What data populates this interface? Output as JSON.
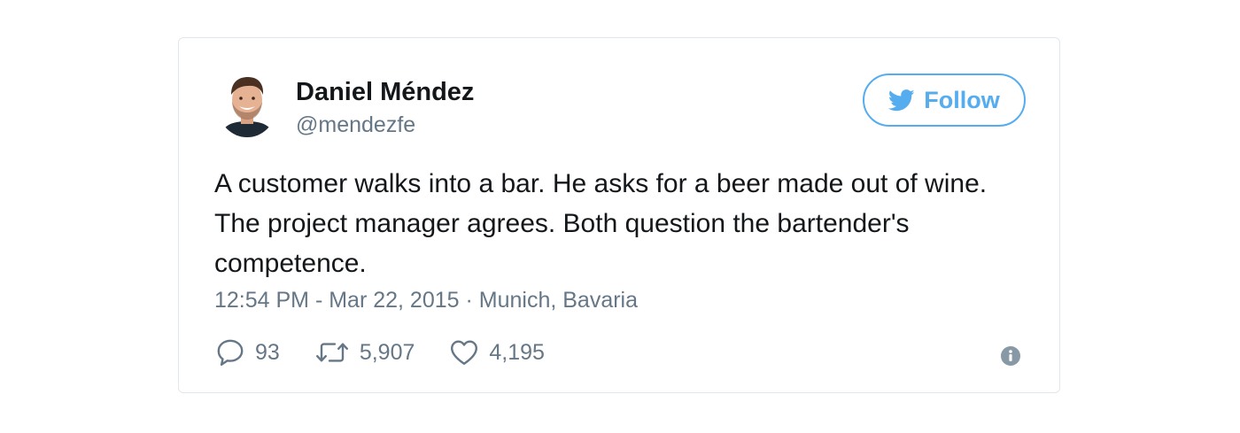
{
  "author": {
    "display_name": "Daniel Méndez",
    "handle": "@mendezfe"
  },
  "follow_button": {
    "label": "Follow",
    "icon": "twitter-bird-icon"
  },
  "tweet": {
    "text": "A customer walks into a bar. He asks for a beer made out of wine. The project manager agrees. Both question the bartender's competence.",
    "meta": "12:54 PM - Mar 22, 2015 · Munich, Bavaria"
  },
  "actions": {
    "replies": "93",
    "retweets": "5,907",
    "likes": "4,195"
  },
  "colors": {
    "accent": "#55acee",
    "text": "#14171a",
    "muted": "#657786",
    "border": "#e1e8ed"
  }
}
